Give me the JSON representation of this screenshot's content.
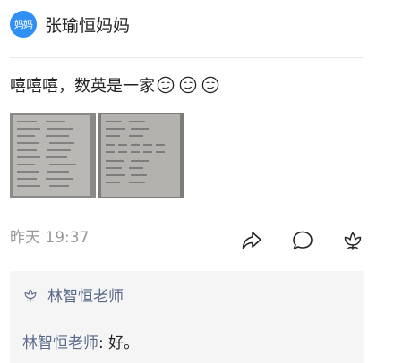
{
  "post": {
    "avatar_text": "妈妈",
    "author": "张瑜恒妈妈",
    "text": "嘻嘻嘻，数英是一家",
    "emoji_count": 3,
    "images": [
      "homework-photo-1",
      "homework-photo-2"
    ],
    "time": "昨天 19:37"
  },
  "actions": {
    "share_icon": "share-icon",
    "comment_icon": "comment-icon",
    "like_icon": "flower-like-icon"
  },
  "comments": {
    "likers": "林智恒老师",
    "items": [
      {
        "author": "林智恒老师",
        "separator": ": ",
        "text": "好。"
      }
    ]
  }
}
